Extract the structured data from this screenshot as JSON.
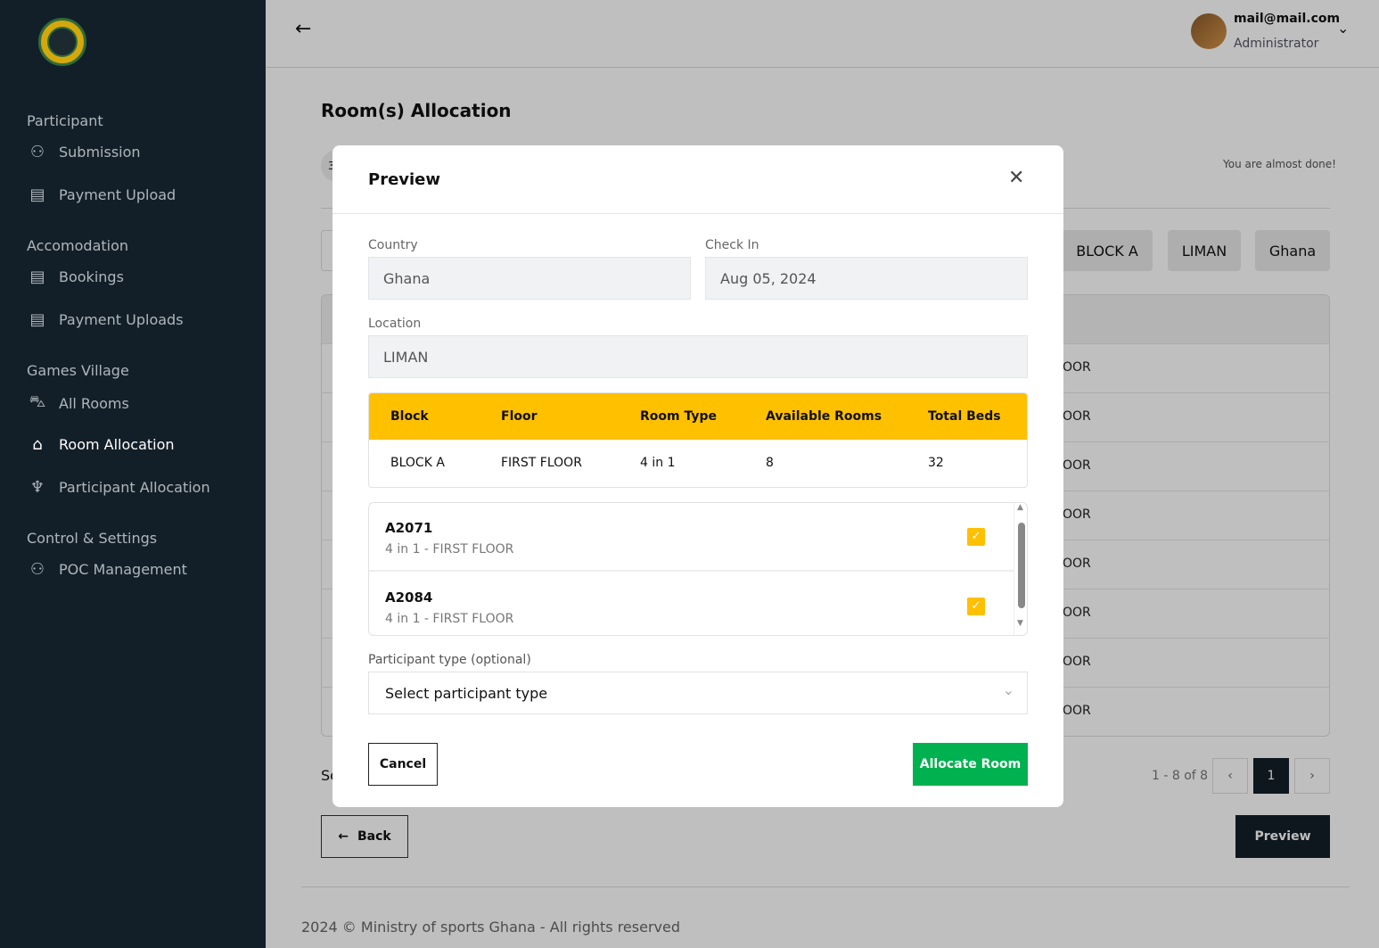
{
  "sidebar": {
    "sections": [
      {
        "title": "Participant",
        "items": [
          {
            "label": "Submission",
            "icon": "user-icon"
          },
          {
            "label": "Payment Upload",
            "icon": "document-icon"
          }
        ]
      },
      {
        "title": "Accomodation",
        "items": [
          {
            "label": "Bookings",
            "icon": "document-icon"
          },
          {
            "label": "Payment Uploads",
            "icon": "document-icon"
          }
        ]
      },
      {
        "title": "Games Village",
        "items": [
          {
            "label": "All Rooms",
            "icon": "bed-icon"
          },
          {
            "label": "Room Allocation",
            "icon": "home-icon",
            "active": true
          },
          {
            "label": "Participant Allocation",
            "icon": "trophy-icon"
          }
        ]
      },
      {
        "title": "Control & Settings",
        "items": [
          {
            "label": "POC Management",
            "icon": "users-icon"
          }
        ]
      }
    ]
  },
  "header": {
    "email": "mail@mail.com",
    "role": "Administrator"
  },
  "page": {
    "title": "Room(s) Allocation",
    "step": "3",
    "step_hint": "You are almost done!",
    "chips": [
      "BLOCK A",
      "LIMAN",
      "Ghana"
    ],
    "row_suffix": "OOR",
    "selected_prefix": "Se",
    "pagination": "1 - 8 of 8",
    "current_page": "1",
    "back": "Back",
    "preview": "Preview",
    "footer": "2024 © Ministry of sports Ghana - All rights reserved"
  },
  "modal": {
    "title": "Preview",
    "country_label": "Country",
    "country": "Ghana",
    "checkin_label": "Check In",
    "checkin": "Aug 05, 2024",
    "location_label": "Location",
    "location": "LIMAN",
    "table": {
      "headers": [
        "Block",
        "Floor",
        "Room Type",
        "Available Rooms",
        "Total Beds"
      ],
      "row": [
        "BLOCK A",
        "FIRST FLOOR",
        "4 in 1",
        "8",
        "32"
      ]
    },
    "rooms": [
      {
        "code": "A2071",
        "desc": "4 in 1 - FIRST FLOOR",
        "checked": true
      },
      {
        "code": "A2084",
        "desc": "4 in 1 - FIRST FLOOR",
        "checked": true
      }
    ],
    "ptype_label": "Participant type (optional)",
    "ptype_placeholder": "Select participant type",
    "cancel": "Cancel",
    "allocate": "Allocate Room"
  },
  "colors": {
    "sidebar": "#131f28",
    "accent": "#ffc000",
    "primary": "#00b14f"
  }
}
